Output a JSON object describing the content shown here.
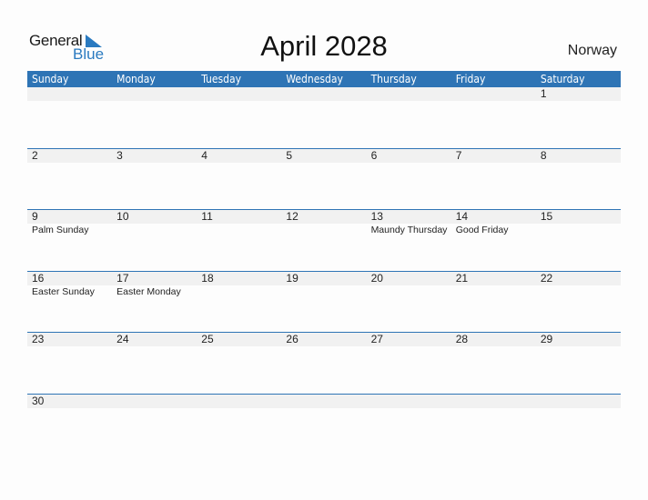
{
  "logo": {
    "word1": "General",
    "word2": "Blue",
    "icon": "triangle-flag-icon"
  },
  "title": "April 2028",
  "country": "Norway",
  "colors": {
    "accent": "#2e74b5",
    "band": "#f1f1f1"
  },
  "weekdays": [
    "Sunday",
    "Monday",
    "Tuesday",
    "Wednesday",
    "Thursday",
    "Friday",
    "Saturday"
  ],
  "weeks": [
    [
      {
        "day": "",
        "holiday": ""
      },
      {
        "day": "",
        "holiday": ""
      },
      {
        "day": "",
        "holiday": ""
      },
      {
        "day": "",
        "holiday": ""
      },
      {
        "day": "",
        "holiday": ""
      },
      {
        "day": "",
        "holiday": ""
      },
      {
        "day": "1",
        "holiday": ""
      }
    ],
    [
      {
        "day": "2",
        "holiday": ""
      },
      {
        "day": "3",
        "holiday": ""
      },
      {
        "day": "4",
        "holiday": ""
      },
      {
        "day": "5",
        "holiday": ""
      },
      {
        "day": "6",
        "holiday": ""
      },
      {
        "day": "7",
        "holiday": ""
      },
      {
        "day": "8",
        "holiday": ""
      }
    ],
    [
      {
        "day": "9",
        "holiday": "Palm Sunday"
      },
      {
        "day": "10",
        "holiday": ""
      },
      {
        "day": "11",
        "holiday": ""
      },
      {
        "day": "12",
        "holiday": ""
      },
      {
        "day": "13",
        "holiday": "Maundy Thursday"
      },
      {
        "day": "14",
        "holiday": "Good Friday"
      },
      {
        "day": "15",
        "holiday": ""
      }
    ],
    [
      {
        "day": "16",
        "holiday": "Easter Sunday"
      },
      {
        "day": "17",
        "holiday": "Easter Monday"
      },
      {
        "day": "18",
        "holiday": ""
      },
      {
        "day": "19",
        "holiday": ""
      },
      {
        "day": "20",
        "holiday": ""
      },
      {
        "day": "21",
        "holiday": ""
      },
      {
        "day": "22",
        "holiday": ""
      }
    ],
    [
      {
        "day": "23",
        "holiday": ""
      },
      {
        "day": "24",
        "holiday": ""
      },
      {
        "day": "25",
        "holiday": ""
      },
      {
        "day": "26",
        "holiday": ""
      },
      {
        "day": "27",
        "holiday": ""
      },
      {
        "day": "28",
        "holiday": ""
      },
      {
        "day": "29",
        "holiday": ""
      }
    ],
    [
      {
        "day": "30",
        "holiday": ""
      },
      {
        "day": "",
        "holiday": ""
      },
      {
        "day": "",
        "holiday": ""
      },
      {
        "day": "",
        "holiday": ""
      },
      {
        "day": "",
        "holiday": ""
      },
      {
        "day": "",
        "holiday": ""
      },
      {
        "day": "",
        "holiday": ""
      }
    ]
  ]
}
